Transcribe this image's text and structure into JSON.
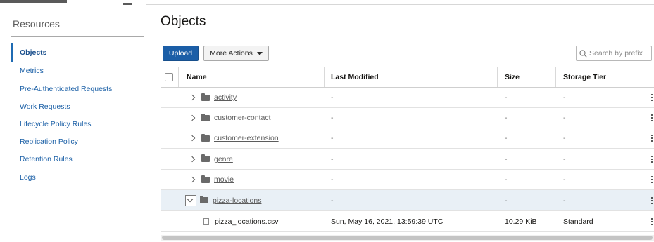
{
  "sidebar": {
    "title": "Resources",
    "items": [
      {
        "label": "Objects",
        "active": true
      },
      {
        "label": "Metrics"
      },
      {
        "label": "Pre-Authenticated Requests"
      },
      {
        "label": "Work Requests"
      },
      {
        "label": "Lifecycle Policy Rules"
      },
      {
        "label": "Replication Policy"
      },
      {
        "label": "Retention Rules"
      },
      {
        "label": "Logs"
      }
    ]
  },
  "main": {
    "title": "Objects",
    "toolbar": {
      "upload_label": "Upload",
      "more_actions_label": "More Actions",
      "search_placeholder": "Search by prefix"
    },
    "table": {
      "columns": [
        "Name",
        "Last Modified",
        "Size",
        "Storage Tier"
      ],
      "rows": [
        {
          "type": "folder",
          "name": "activity",
          "modified": "-",
          "size": "-",
          "tier": "-"
        },
        {
          "type": "folder",
          "name": "customer-contact",
          "modified": "-",
          "size": "-",
          "tier": "-"
        },
        {
          "type": "folder",
          "name": "customer-extension",
          "modified": "-",
          "size": "-",
          "tier": "-"
        },
        {
          "type": "folder",
          "name": "genre",
          "modified": "-",
          "size": "-",
          "tier": "-"
        },
        {
          "type": "folder",
          "name": "movie",
          "modified": "-",
          "size": "-",
          "tier": "-"
        },
        {
          "type": "folder",
          "name": "pizza-locations",
          "modified": "-",
          "size": "-",
          "tier": "-",
          "expanded": true
        },
        {
          "type": "file",
          "name": "pizza_locations.csv",
          "modified": "Sun, May 16, 2021, 13:59:39 UTC",
          "size": "10.29 KiB",
          "tier": "Standard"
        }
      ]
    }
  },
  "colors": {
    "accent": "#1b5ea7",
    "link": "#1a5fa6",
    "selected_row": "#e9f0f6"
  },
  "icons": [
    "search-icon",
    "folder-icon",
    "file-icon",
    "chevron-right-icon",
    "chevron-down-icon",
    "caret-down-icon",
    "kebab-menu-icon"
  ]
}
